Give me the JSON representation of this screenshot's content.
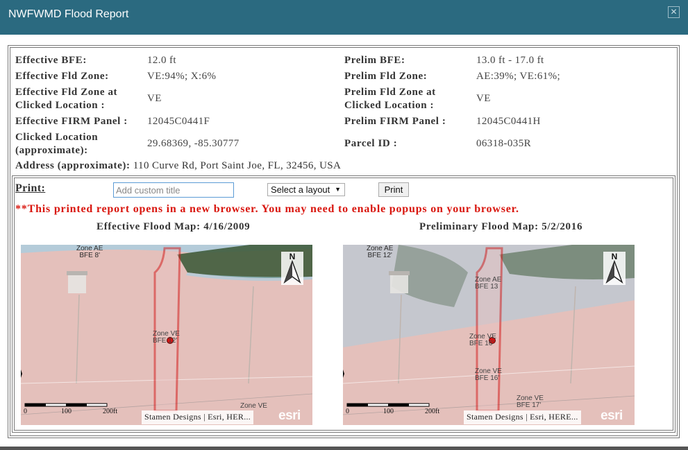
{
  "window": {
    "title": "NWFWMD Flood Report",
    "close_glyph": "✕"
  },
  "info": {
    "effective_bfe_label": "Effective BFE:",
    "effective_bfe_value": "12.0 ft",
    "prelim_bfe_label": "Prelim BFE:",
    "prelim_bfe_value": "13.0 ft - 17.0 ft",
    "effective_zone_label": "Effective Fld Zone:",
    "effective_zone_value": "VE:94%; X:6%",
    "prelim_zone_label": "Prelim Fld Zone:",
    "prelim_zone_value": "AE:39%; VE:61%;",
    "effective_zone_click_label_1": "Effective Fld Zone at",
    "effective_zone_click_label_2": "Clicked Location :",
    "effective_zone_click_value": "VE",
    "prelim_zone_click_label_1": "Prelim Fld Zone at",
    "prelim_zone_click_label_2": "Clicked Location :",
    "prelim_zone_click_value": "VE",
    "effective_firm_label": "Effective FIRM Panel :",
    "effective_firm_value": "12045C0441F",
    "prelim_firm_label": "Prelim FIRM Panel :",
    "prelim_firm_value": "12045C0441H",
    "clicked_location_label_1": "Clicked Location",
    "clicked_location_label_2": "(approximate):",
    "clicked_location_value": "29.68369, -85.30777",
    "parcel_label": "Parcel ID :",
    "parcel_value": "06318-035R",
    "address_label": "Address (approximate):",
    "address_value": "110 Curve Rd, Port Saint Joe, FL, 32456, USA"
  },
  "print": {
    "label": "Print:",
    "title_placeholder": "Add custom title",
    "layout_select": "Select a layout",
    "layout_caret": "▼",
    "button": "Print",
    "warning": "**This printed report opens in a new browser. You may need to enable popups on your browser."
  },
  "maps": {
    "effective": {
      "heading": "Effective Flood Map: 4/16/2009",
      "zone_labels": [
        {
          "line1": "Zone AE",
          "line2": "BFE 8'"
        },
        {
          "line1": "Zone VE",
          "line2": "BFE 12'"
        },
        {
          "line1": "Zone VE",
          "line2": ""
        }
      ],
      "scale_labels": [
        "0",
        "100",
        "200ft"
      ],
      "attribution": "Stamen Designs | Esri, HER...",
      "logo": "esri",
      "north": "N"
    },
    "preliminary": {
      "heading": "Preliminary Flood Map: 5/2/2016",
      "zone_labels": [
        {
          "line1": "Zone AE",
          "line2": "BFE 12'"
        },
        {
          "line1": "Zone AE",
          "line2": "BFE 13"
        },
        {
          "line1": "Zone VE",
          "line2": "BFE 16'"
        },
        {
          "line1": "Zone VE",
          "line2": "BFE 16'"
        },
        {
          "line1": "Zone VE",
          "line2": "BFE 17'"
        }
      ],
      "scale_labels": [
        "0",
        "100",
        "200ft"
      ],
      "attribution": "Stamen Designs | Esri, HERE...",
      "logo": "esri",
      "north": "N"
    }
  },
  "colors": {
    "titlebar": "#2b6a80",
    "warning": "#d9160e",
    "parcel_outline": "#d41515",
    "zone_ve_fill": "#f2b8b8",
    "zone_ae_fill": "#9fd0e6"
  }
}
